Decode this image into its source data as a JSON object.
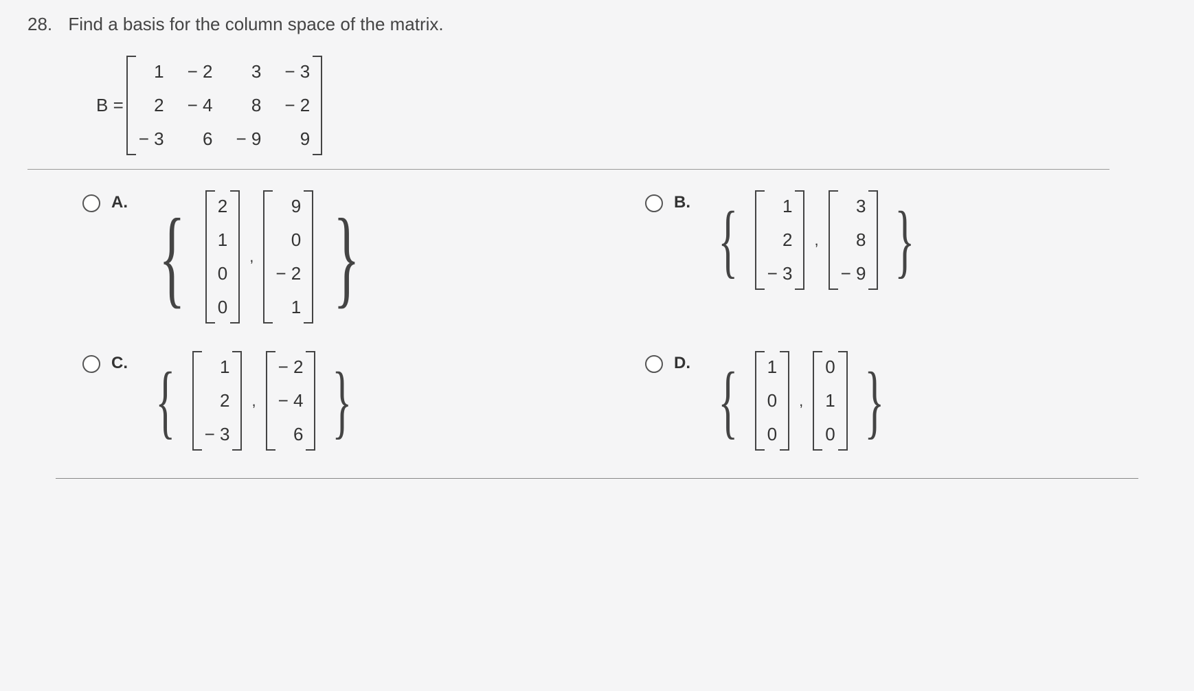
{
  "question": {
    "number": "28.",
    "text": "Find a basis for the column space of the matrix.",
    "matrix_label": "B =",
    "matrix": [
      [
        "1",
        "− 2",
        "3",
        "− 3"
      ],
      [
        "2",
        "− 4",
        "8",
        "− 2"
      ],
      [
        "− 3",
        "6",
        "− 9",
        "9"
      ]
    ]
  },
  "options": {
    "A": {
      "label": "A.",
      "vectors": [
        [
          "2",
          "1",
          "0",
          "0"
        ],
        [
          "9",
          "0",
          "− 2",
          "1"
        ]
      ]
    },
    "B": {
      "label": "B.",
      "vectors": [
        [
          "1",
          "2",
          "− 3"
        ],
        [
          "3",
          "8",
          "− 9"
        ]
      ]
    },
    "C": {
      "label": "C.",
      "vectors": [
        [
          "1",
          "2",
          "− 3"
        ],
        [
          "− 2",
          "− 4",
          "6"
        ]
      ]
    },
    "D": {
      "label": "D.",
      "vectors": [
        [
          "1",
          "0",
          "0"
        ],
        [
          "0",
          "1",
          "0"
        ]
      ]
    }
  }
}
